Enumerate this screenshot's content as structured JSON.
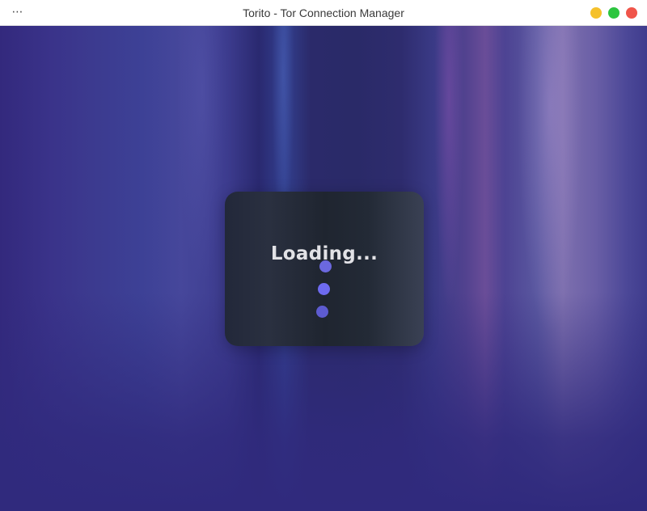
{
  "window": {
    "title": "Torito - Tor Connection Manager",
    "menu_glyph": "⋯",
    "controls": [
      {
        "name": "minimize",
        "color": "#f5c12b"
      },
      {
        "name": "maximize",
        "color": "#2cc53f"
      },
      {
        "name": "close",
        "color": "#f0554a"
      }
    ]
  },
  "loader": {
    "text": "Loading...",
    "dot_colors": [
      "#6b68df",
      "#6e6bf0",
      "#5d5bd0"
    ]
  },
  "colors": {
    "accent": "#6e6bf0",
    "background_base": "#302a7d"
  }
}
